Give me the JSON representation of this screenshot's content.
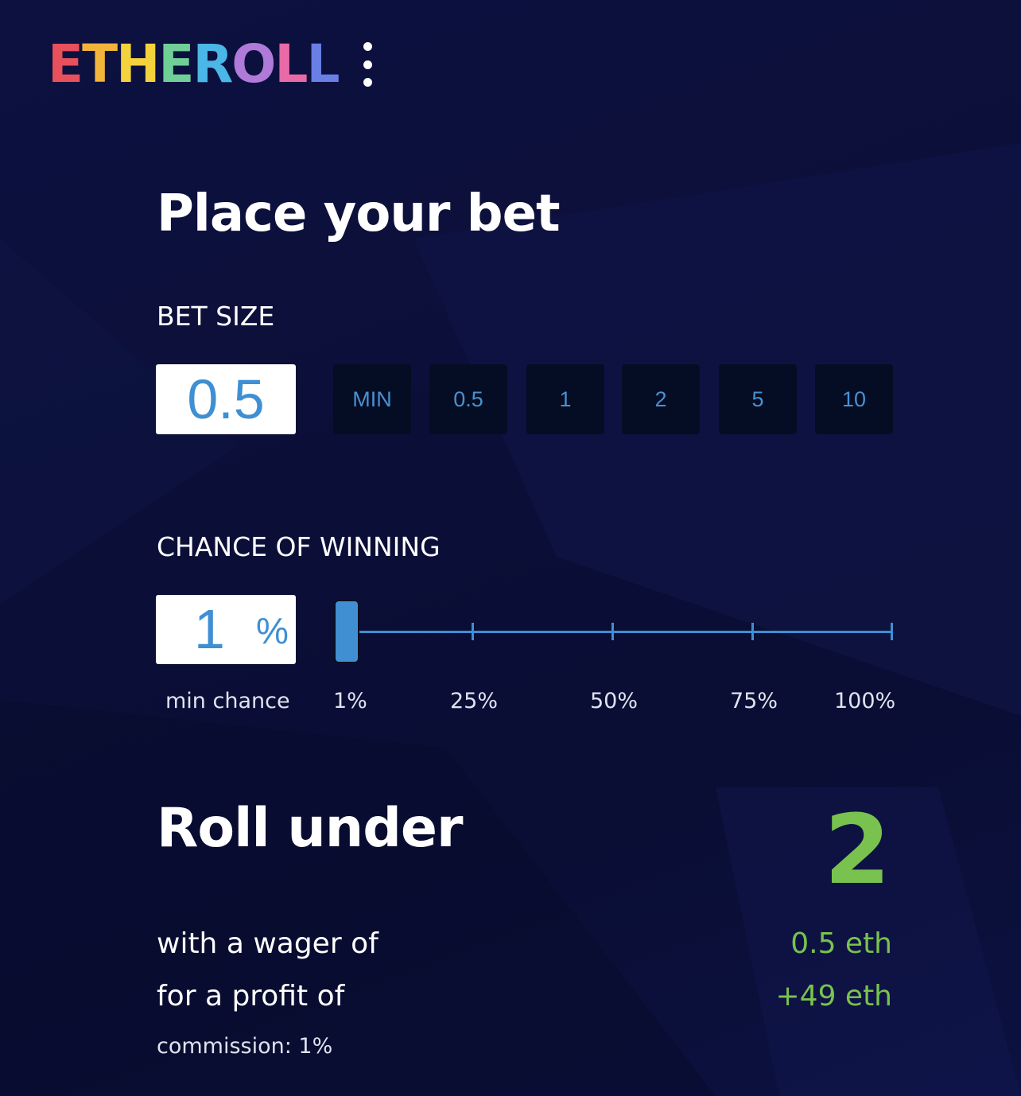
{
  "header": {
    "logo_text": "ETHEROLL",
    "logo_colors": [
      "#e8505b",
      "#f3b43b",
      "#f3d23c",
      "#6fcf97",
      "#4ab7e6",
      "#b07ad9",
      "#e86aa6",
      "#6a7fe6"
    ]
  },
  "bet": {
    "title": "Place your bet",
    "size_label": "BET SIZE",
    "size_value": "0.5",
    "presets": [
      "MIN",
      "0.5",
      "1",
      "2",
      "5",
      "10"
    ]
  },
  "chance": {
    "label": "CHANCE OF WINNING",
    "value": "1",
    "unit": "%",
    "slider_value_percent": 1,
    "min_label": "min chance",
    "ticks": [
      "1%",
      "25%",
      "50%",
      "75%",
      "100%"
    ]
  },
  "result": {
    "roll_label": "Roll under",
    "roll_number": "2",
    "wager_label": "with a wager of",
    "wager_value": "0.5 eth",
    "profit_label": "for a profit of",
    "profit_value": "+49 eth",
    "commission": "commission: 1%"
  },
  "colors": {
    "accent_blue": "#3f8fd2",
    "profit_green": "#79c24f",
    "chip_bg": "#050d24",
    "background": "#0b0f38"
  },
  "icons": {
    "menu": "kebab-menu-icon"
  }
}
